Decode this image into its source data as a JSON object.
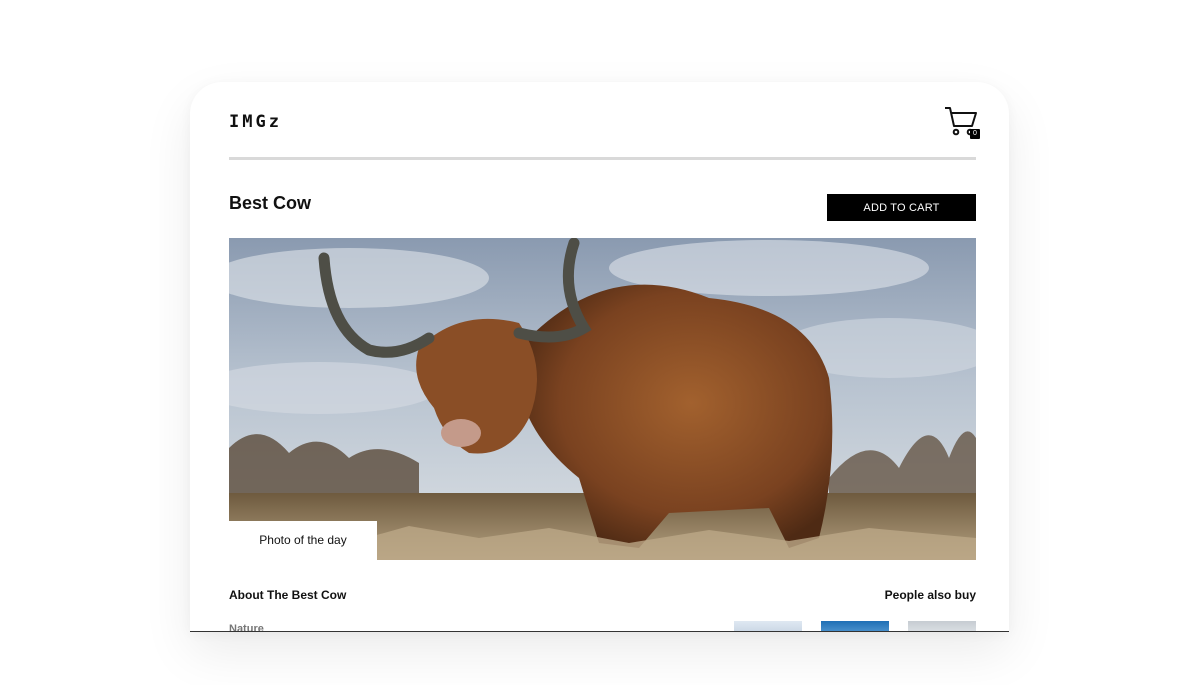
{
  "app": {
    "logo": "IMGz"
  },
  "cart": {
    "count": "0"
  },
  "product": {
    "title": "Best Cow",
    "add_to_cart_label": "ADD TO CART",
    "photo_label": "Photo of the day",
    "about_heading": "About The Best Cow",
    "category": "Nature"
  },
  "related": {
    "heading": "People also buy"
  }
}
